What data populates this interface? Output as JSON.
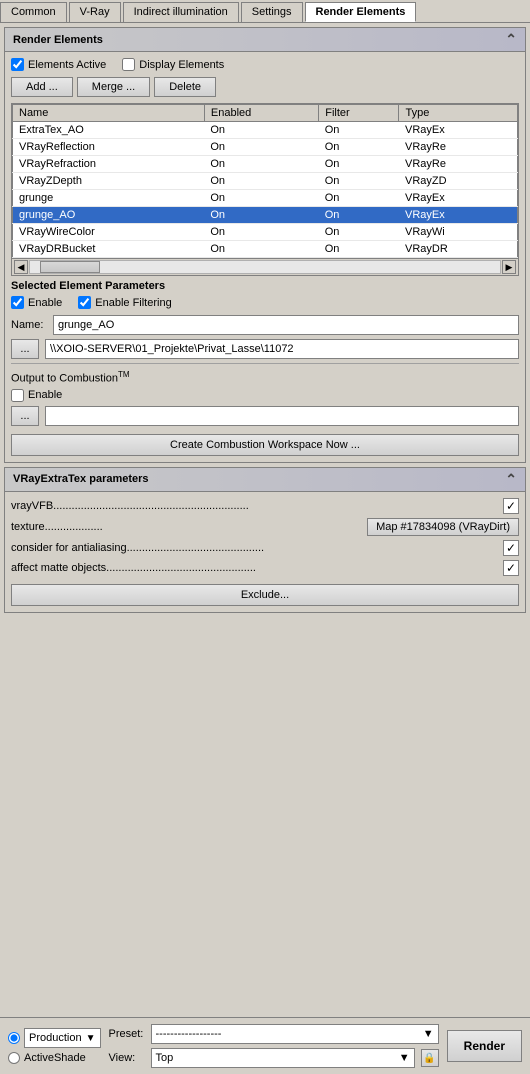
{
  "tabs": [
    {
      "id": "common",
      "label": "Common",
      "active": false
    },
    {
      "id": "vray",
      "label": "V-Ray",
      "active": false
    },
    {
      "id": "indirect",
      "label": "Indirect illumination",
      "active": false
    },
    {
      "id": "settings",
      "label": "Settings",
      "active": false
    },
    {
      "id": "render-elements",
      "label": "Render Elements",
      "active": true
    }
  ],
  "render_elements_panel": {
    "title": "Render Elements",
    "elements_active_label": "Elements Active",
    "display_elements_label": "Display Elements",
    "elements_active_checked": true,
    "display_elements_checked": false,
    "add_button": "Add ...",
    "merge_button": "Merge ...",
    "delete_button": "Delete",
    "table": {
      "headers": [
        "Name",
        "Enabled",
        "Filter",
        "Type"
      ],
      "rows": [
        {
          "name": "ExtraTex_AO",
          "enabled": "On",
          "filter": "On",
          "type": "VRayEx",
          "selected": false
        },
        {
          "name": "VRayReflection",
          "enabled": "On",
          "filter": "On",
          "type": "VRayRe",
          "selected": false
        },
        {
          "name": "VRayRefraction",
          "enabled": "On",
          "filter": "On",
          "type": "VRayRe",
          "selected": false
        },
        {
          "name": "VRayZDepth",
          "enabled": "On",
          "filter": "On",
          "type": "VRayZD",
          "selected": false
        },
        {
          "name": "grunge",
          "enabled": "On",
          "filter": "On",
          "type": "VRayEx",
          "selected": false
        },
        {
          "name": "grunge_AO",
          "enabled": "On",
          "filter": "On",
          "type": "VRayEx",
          "selected": true
        },
        {
          "name": "VRayWireColor",
          "enabled": "On",
          "filter": "On",
          "type": "VRayWi",
          "selected": false
        },
        {
          "name": "VRayDRBucket",
          "enabled": "On",
          "filter": "On",
          "type": "VRayDR",
          "selected": false
        }
      ]
    }
  },
  "selected_element": {
    "title": "Selected Element Parameters",
    "enable_label": "Enable",
    "enable_filtering_label": "Enable Filtering",
    "enable_checked": true,
    "enable_filtering_checked": true,
    "name_label": "Name:",
    "name_value": "grunge_AO",
    "path_value": "\\\\XOIO-SERVER\\01_Projekte\\Privat_Lasse\\11072",
    "browse_button": "..."
  },
  "combustion": {
    "title": "Output to Combustion",
    "superscript": "TM",
    "enable_label": "Enable",
    "enable_checked": false,
    "browse_button": "...",
    "path_value": "",
    "create_button": "Create Combustion Workspace Now ..."
  },
  "vray_params": {
    "title": "VRayExtraTex parameters",
    "params": [
      {
        "label": "vrayVFB",
        "dots": "................................................................",
        "type": "checkbox",
        "checked": true
      },
      {
        "label": "texture",
        "dots": "...................",
        "type": "button",
        "button_label": "Map #17834098  (VRayDirt)"
      },
      {
        "label": "consider for antialiasing",
        "dots": ".............................................",
        "type": "checkbox",
        "checked": true
      },
      {
        "label": "affect matte objects",
        "dots": ".................................................",
        "type": "checkbox",
        "checked": true
      }
    ],
    "exclude_button": "Exclude..."
  },
  "bottom": {
    "production_label": "Production",
    "activeshade_label": "ActiveShade",
    "production_selected": true,
    "preset_label": "Preset:",
    "preset_value": "------------------",
    "view_label": "View:",
    "view_value": "Top",
    "render_button": "Render"
  }
}
